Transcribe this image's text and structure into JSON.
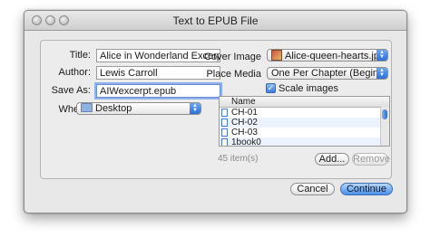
{
  "window": {
    "title": "Text to EPUB File"
  },
  "left": {
    "title_label": "Title:",
    "title_value": "Alice in Wonderland Excerpt",
    "author_label": "Author:",
    "author_value": "Lewis Carroll",
    "saveas_label": "Save As:",
    "saveas_value": "AIWexcerpt.epub",
    "where_label": "Where:",
    "where_value": "Desktop",
    "where_icon": "folder-icon"
  },
  "right": {
    "cover_label": "Cover Image",
    "cover_value": "Alice-queen-hearts.jpg",
    "cover_icon": "image-thumbnail-icon",
    "place_label": "Place Media",
    "place_value": "One Per Chapter (Beginning)",
    "scale_label": "Scale images",
    "scale_checked": true
  },
  "table": {
    "column": "Name",
    "rows": [
      "CH-01",
      "CH-02",
      "CH-03",
      "1book0"
    ],
    "count": "45 item(s)"
  },
  "buttons": {
    "add": "Add...",
    "remove": "Remove",
    "cancel": "Cancel",
    "continue": "Continue"
  },
  "colors": {
    "accent": "#3a7fe3",
    "focus": "#8fb2ee"
  }
}
